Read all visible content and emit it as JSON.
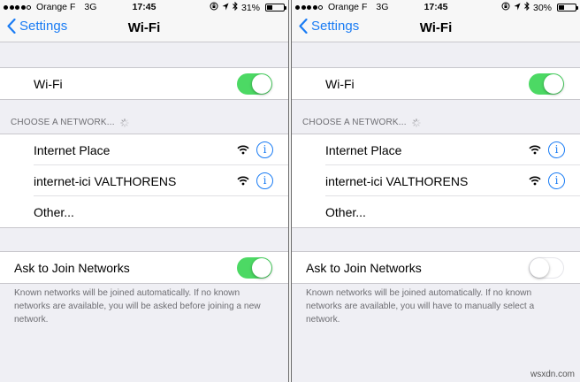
{
  "screens": [
    {
      "status": {
        "carrier": "Orange F",
        "network": "3G",
        "time": "17:45",
        "battery": "31%",
        "battery_level": 0.31
      },
      "nav": {
        "back_label": "Settings",
        "title": "Wi-Fi"
      },
      "wifi_row": {
        "label": "Wi-Fi",
        "toggle": "on"
      },
      "choose_header": "CHOOSE A NETWORK...",
      "networks": [
        {
          "name": "Internet Place",
          "info": "i"
        },
        {
          "name": "internet-ici VALTHORENS",
          "info": "i"
        }
      ],
      "other_label": "Other...",
      "ask_row": {
        "label": "Ask to Join Networks",
        "toggle": "on"
      },
      "footer": "Known networks will be joined automatically. If no known networks are available, you will be asked before joining a new network."
    },
    {
      "status": {
        "carrier": "Orange F",
        "network": "3G",
        "time": "17:45",
        "battery": "30%",
        "battery_level": 0.3
      },
      "nav": {
        "back_label": "Settings",
        "title": "Wi-Fi"
      },
      "wifi_row": {
        "label": "Wi-Fi",
        "toggle": "on"
      },
      "choose_header": "CHOOSE A NETWORK...",
      "networks": [
        {
          "name": "Internet Place",
          "info": "i"
        },
        {
          "name": "internet-ici VALTHORENS",
          "info": "i"
        }
      ],
      "other_label": "Other...",
      "ask_row": {
        "label": "Ask to Join Networks",
        "toggle": "off"
      },
      "footer": "Known networks will be joined automatically. If no known networks are available, you will have to manually select a network."
    }
  ],
  "watermark": "wsxdn.com",
  "colors": {
    "accent": "#1a7cf4",
    "toggle_on": "#4cd964",
    "group_bg": "#efeff4"
  },
  "icons": [
    "signal-dots-icon",
    "lock-rotation-icon",
    "location-arrow-icon",
    "bluetooth-icon",
    "battery-icon",
    "chevron-left-icon",
    "wifi-icon",
    "info-icon",
    "spinner-icon"
  ]
}
